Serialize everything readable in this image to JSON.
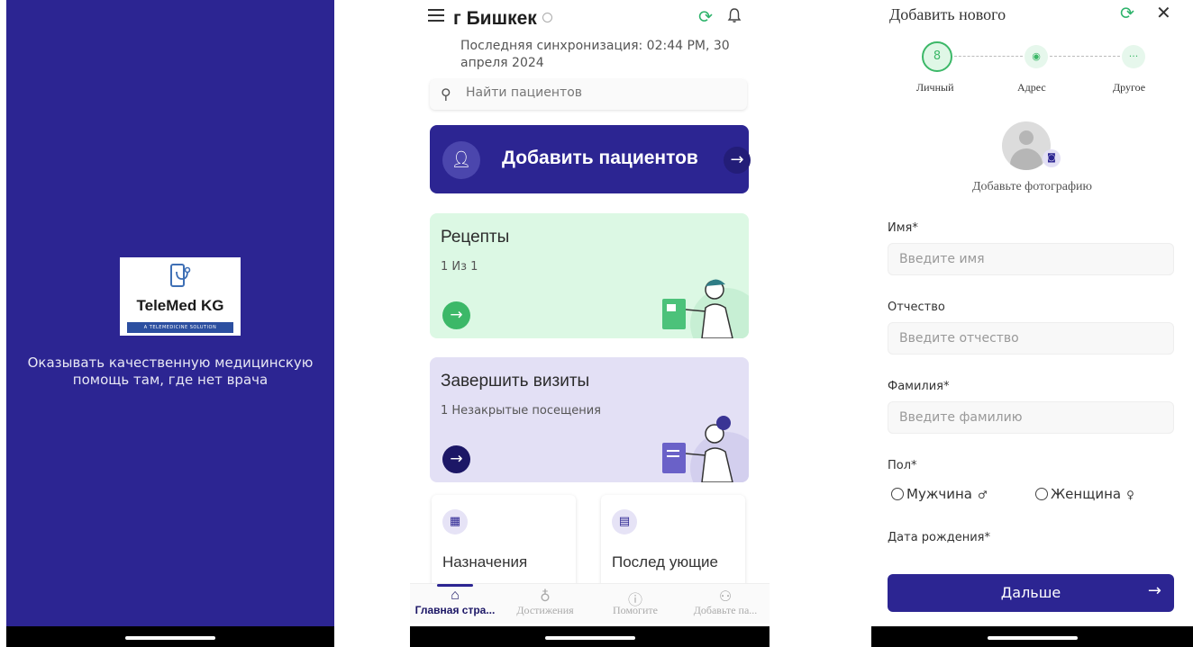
{
  "splash": {
    "logo_text": "TeleMed KG",
    "logo_subtitle": "A TELEMEDICINE SOLUTION",
    "tagline": "Оказывать качественную медицинскую помощь там, где нет врача",
    "background_color": "#2c2592"
  },
  "home": {
    "city": "г Бишкек",
    "sync_text": "Последняя синхронизация: 02:44 PM, 30 апреля 2024",
    "search_placeholder": "Найти пациентов",
    "add_patients_label": "Добавить пациентов",
    "cards": [
      {
        "title": "Рецепты",
        "subtitle": "1 Из 1",
        "color": "#dcf8e4"
      },
      {
        "title": "Завершить визиты",
        "subtitle": "1 Незакрытые посещения",
        "color": "#e3e0f5"
      }
    ],
    "mini_cards": [
      {
        "label": "Назначения",
        "icon": "calendar-icon"
      },
      {
        "label": "Послед ующие",
        "icon": "list-icon"
      }
    ],
    "tabs": [
      {
        "label": "Главная стра...",
        "icon": "home-icon",
        "active": true
      },
      {
        "label": "Достижения",
        "icon": "award-icon",
        "active": false
      },
      {
        "label": "Помогите",
        "icon": "help-icon",
        "active": false
      },
      {
        "label": "Добавьте па...",
        "icon": "add-user-icon",
        "active": false
      }
    ]
  },
  "form": {
    "title": "Добавить нового",
    "steps": [
      "Личный",
      "Адрес",
      "Другое"
    ],
    "photo_label": "Добавьте фотографию",
    "fields": [
      {
        "label": "Имя*",
        "placeholder": "Введите имя"
      },
      {
        "label": "Отчество",
        "placeholder": "Введите отчество"
      },
      {
        "label": "Фамилия*",
        "placeholder": "Введите фамилию"
      }
    ],
    "gender_label": "Пол*",
    "gender_options": [
      "Мужчина",
      "Женщина"
    ],
    "dob_label": "Дата рождения*",
    "next_label": "Дальше"
  },
  "colors": {
    "primary": "#2c2592",
    "accent_green": "#3cb868"
  }
}
